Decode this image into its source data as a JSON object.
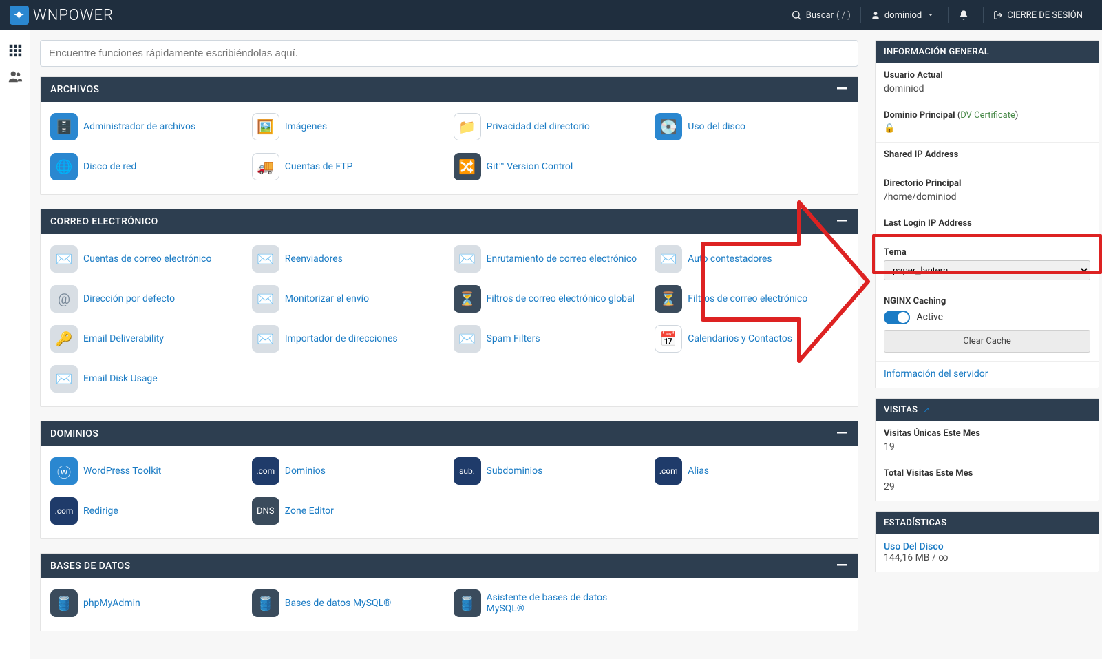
{
  "brand": "WNPOWER",
  "topbar": {
    "search_label": "Buscar",
    "search_paren": "( / )",
    "username": "dominiod",
    "logout": "CIERRE DE SESIÓN"
  },
  "search_placeholder": "Encuentre funciones rápidamente escribiéndolas aquí.",
  "panels": {
    "files": {
      "title": "ARCHIVOS",
      "items": [
        {
          "id": "file-manager",
          "label": "Administrador de archivos"
        },
        {
          "id": "images",
          "label": "Imágenes"
        },
        {
          "id": "dir-privacy",
          "label": "Privacidad del directorio"
        },
        {
          "id": "disk-usage",
          "label": "Uso del disco"
        },
        {
          "id": "net-disk",
          "label": "Disco de red"
        },
        {
          "id": "ftp-accounts",
          "label": "Cuentas de FTP"
        },
        {
          "id": "git",
          "label": "Git™ Version Control"
        }
      ]
    },
    "email": {
      "title": "CORREO ELECTRÓNICO",
      "items": [
        {
          "id": "email-accounts",
          "label": "Cuentas de correo electrónico"
        },
        {
          "id": "forwarders",
          "label": "Reenviadores"
        },
        {
          "id": "email-routing",
          "label": "Enrutamiento de correo electrónico"
        },
        {
          "id": "autoresponders",
          "label": "Auto contestadores"
        },
        {
          "id": "default-address",
          "label": "Dirección por defecto"
        },
        {
          "id": "track-delivery",
          "label": "Monitorizar el envío"
        },
        {
          "id": "global-filters",
          "label": "Filtros de correo electrónico global"
        },
        {
          "id": "email-filters",
          "label": "Filtros de correo electrónico"
        },
        {
          "id": "email-deliverability",
          "label": "Email Deliverability"
        },
        {
          "id": "address-importer",
          "label": "Importador de direcciones"
        },
        {
          "id": "spam-filters",
          "label": "Spam Filters"
        },
        {
          "id": "calendars-contacts",
          "label": "Calendarios y Contactos"
        },
        {
          "id": "email-disk-usage",
          "label": "Email Disk Usage"
        }
      ]
    },
    "domains": {
      "title": "DOMINIOS",
      "items": [
        {
          "id": "wp-toolkit",
          "label": "WordPress Toolkit"
        },
        {
          "id": "domains",
          "label": "Dominios"
        },
        {
          "id": "subdomains",
          "label": "Subdominios"
        },
        {
          "id": "aliases",
          "label": "Alias"
        },
        {
          "id": "redirects",
          "label": "Redirige"
        },
        {
          "id": "zone-editor",
          "label": "Zone Editor"
        }
      ]
    },
    "databases": {
      "title": "BASES DE DATOS",
      "items": [
        {
          "id": "phpmyadmin",
          "label": "phpMyAdmin"
        },
        {
          "id": "mysql-dbs",
          "label": "Bases de datos MySQL®"
        },
        {
          "id": "mysql-wizard",
          "label": "Asistente de bases de datos MySQL®"
        }
      ]
    }
  },
  "info": {
    "title": "INFORMACIÓN GENERAL",
    "current_user_label": "Usuario Actual",
    "current_user": "dominiod",
    "primary_domain_label": "Dominio Principal",
    "dv_label": "DV",
    "dv_suffix": "Certificate",
    "shared_ip_label": "Shared IP Address",
    "home_dir_label": "Directorio Principal",
    "home_dir": "/home/dominiod",
    "last_login_label": "Last Login IP Address",
    "theme_label": "Tema",
    "theme_value": "paper_lantern",
    "nginx_label": "NGINX Caching",
    "nginx_state": "Active",
    "clear_cache": "Clear Cache",
    "server_info": "Información del servidor"
  },
  "visits": {
    "title": "VISITAS",
    "unique_label": "Visitas Únicas Este Mes",
    "unique_value": "19",
    "total_label": "Total Visitas Este Mes",
    "total_value": "29"
  },
  "stats": {
    "title": "ESTADÍSTICAS",
    "disk_label": "Uso Del Disco",
    "disk_value": "144,16 MB / ∞"
  }
}
